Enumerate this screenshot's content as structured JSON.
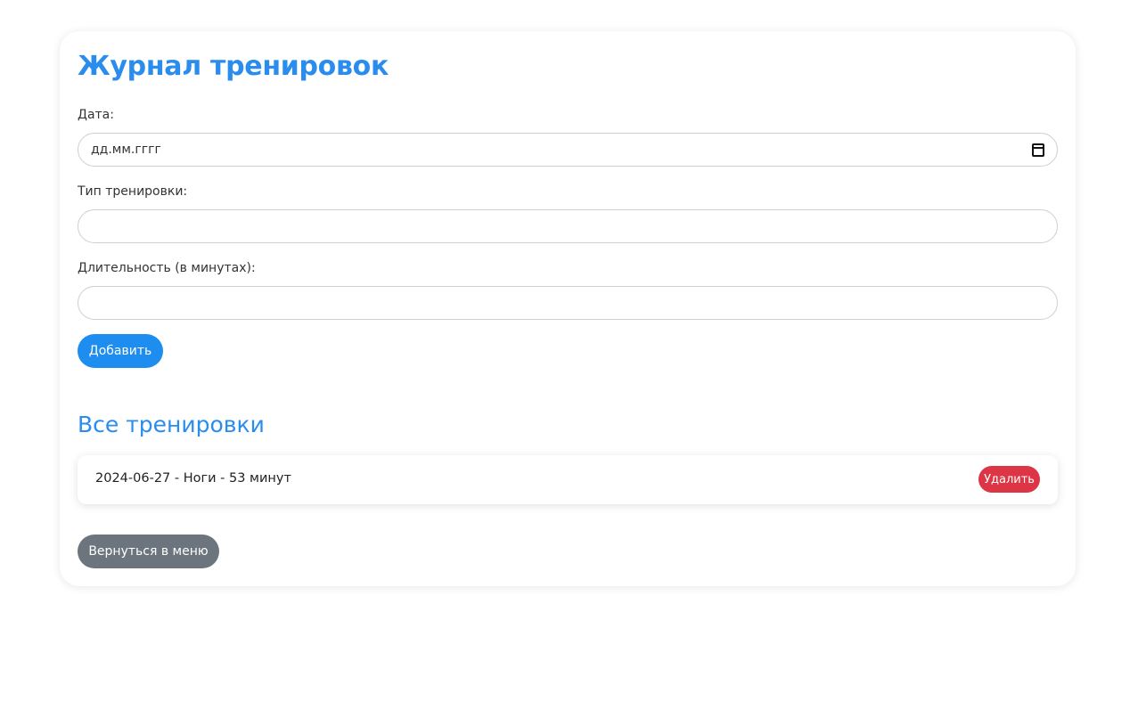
{
  "form": {
    "title": "Журнал тренировок",
    "date_label": "Дата:",
    "date_placeholder": "дд.мм.гггг",
    "type_label": "Тип тренировки:",
    "type_value": "",
    "duration_label": "Длительность (в минутах):",
    "duration_value": "",
    "add_button": "Добавить"
  },
  "list": {
    "title": "Все тренировки",
    "items": [
      {
        "text": "2024-06-27 - Ноги - 53 минут",
        "delete_label": "Удалить"
      }
    ]
  },
  "back_button": "Вернуться в меню",
  "colors": {
    "accent": "#2a8ded",
    "primary_button": "#1e8df0",
    "danger_button": "#dc3545",
    "secondary_button": "#6c757d"
  },
  "icons": {
    "date_picker": "calendar-icon"
  }
}
